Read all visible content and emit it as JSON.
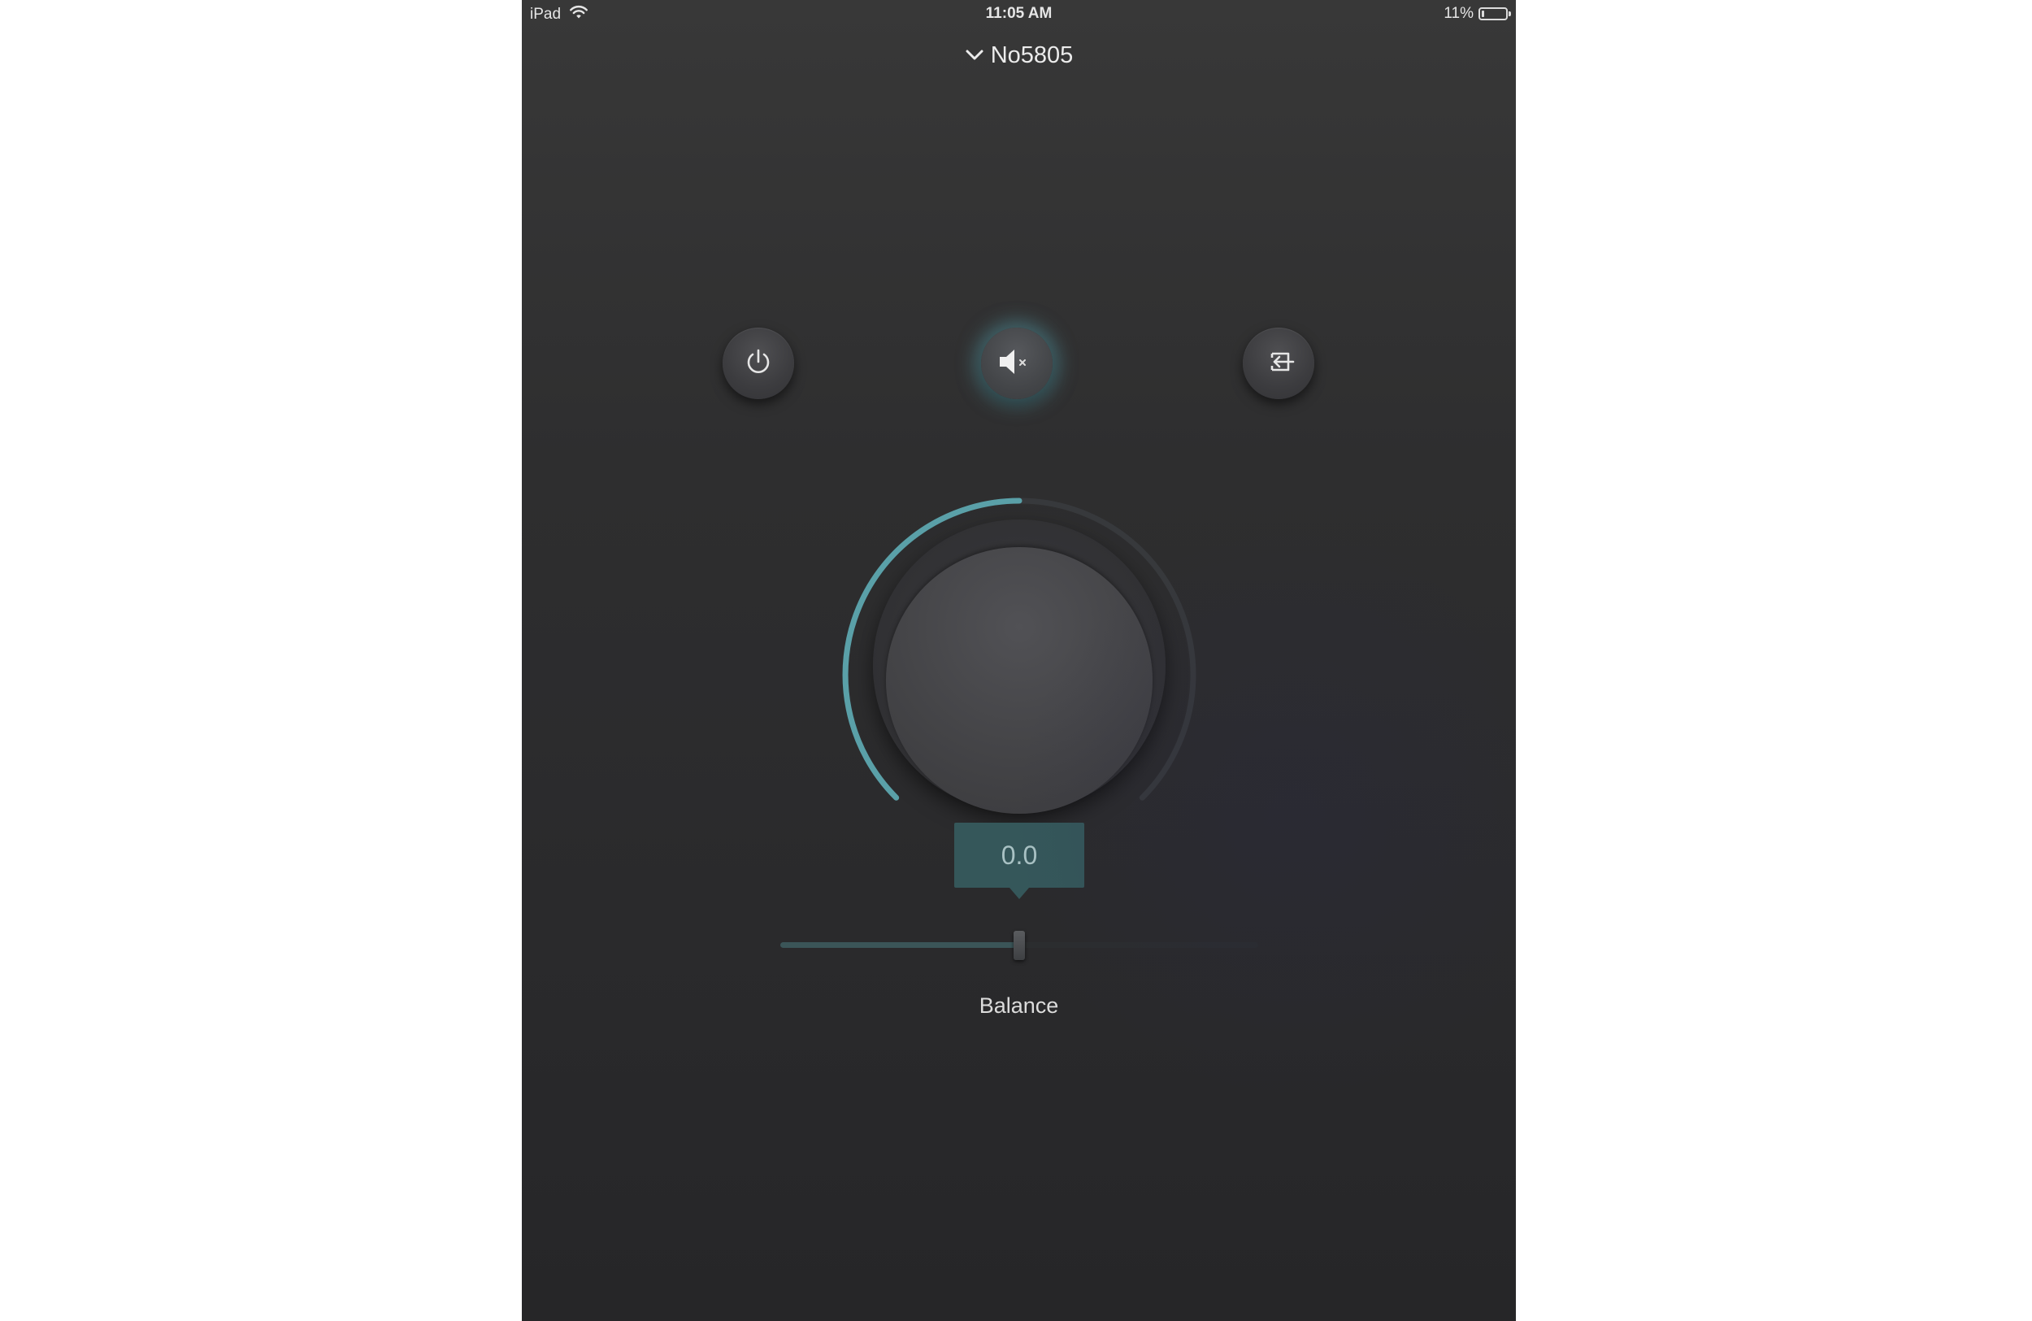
{
  "status_bar": {
    "device_label": "iPad",
    "time": "11:05 AM",
    "battery_percent": "11%",
    "battery_level": 0.11,
    "wifi_icon": "wifi-icon",
    "battery_icon": "battery-icon"
  },
  "device_selector": {
    "name": "No5805",
    "icon": "chevron-down-icon"
  },
  "controls": {
    "power_icon": "power-icon",
    "mute_icon": "speaker-mute-icon",
    "mute_active": true,
    "input_icon": "input-source-icon",
    "accent_color": "#5aa0a8"
  },
  "volume_knob": {
    "level": 0.5
  },
  "balance": {
    "value": "0.0",
    "label": "Balance",
    "position": 0.5
  }
}
